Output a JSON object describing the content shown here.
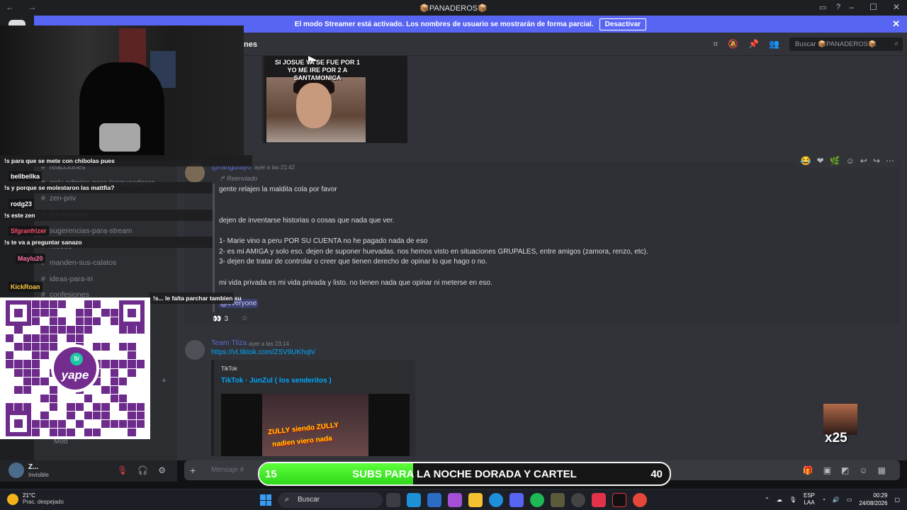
{
  "window": {
    "title": "📦PANADEROS📦"
  },
  "streamer_banner": {
    "text": "El modo Streamer está activado. Los nombres de usuario se mostrarán de forma parcial.",
    "button": "Desactivar"
  },
  "header": {
    "channel": "nes",
    "search_placeholder": "Buscar 📦PANADEROS📦"
  },
  "sidebar": {
    "channels": [
      "reacciones",
      "only-admins-para-tanqueadores",
      "zen-priv",
      "full-tanqueo",
      "sugerencias-para-stream",
      "moods",
      "manden-sus-calatos",
      "ideas-para-iri",
      "confesiones"
    ],
    "bottom_label": "Mod"
  },
  "video": {
    "caption": "SI JOSUE VA SE FUE POR 1\nYO ME IRE POR 2 A SANTAMONICA"
  },
  "message1": {
    "author": "@rangulayo",
    "timestamp": "ayer a las 21:42",
    "forwarded": "Reenviado",
    "lines": [
      "gente relajen la maldita cola por favor",
      "dejen de inventarse historias o cosas que nada que ver.",
      "1- Marie vino a peru POR SU CUENTA no he pagado nada de eso",
      "2- es mi AMIGA y solo eso. dejen de suponer huevadas. nos hemos visto en situaciones GRUPALES, entre amigos (zamora, renzo, etc).",
      "3- dejen de tratar de controlar o creer que tienen derecho de opinar lo que hago o no.",
      "mi vida privada es mi vida privada y listo. no tienen nada que opinar ni meterse en eso."
    ],
    "mention": "@everyone",
    "reaction_emoji": "👀",
    "reaction_count": "3"
  },
  "message2": {
    "author": "Team Tilza",
    "timestamp": "ayer a las 23:14",
    "link": "https://vt.tiktok.com/ZSV9UKhqh/",
    "embed_provider": "TikTok",
    "embed_title": "TikTok · JunZul ( los senderitos )",
    "embed_line1": "ZULLY siendo ZULLY",
    "embed_line2": "nadien viero nada"
  },
  "composer": {
    "placeholder": "Mensaje #"
  },
  "user": {
    "name": "Z...",
    "status": "Invisible"
  },
  "overlay_chat": [
    {
      "text": "!s para que se mete con chibolas pues"
    },
    {
      "user": "bellbellka",
      "color": "#ffffff"
    },
    {
      "text": "!s y porque se molestaron las mattfia?"
    },
    {
      "user": "rodg23",
      "color": "#ffffff"
    },
    {
      "text": "!s este zen"
    },
    {
      "user": "Sfgranfrizer",
      "color": "#ff4d6d"
    },
    {
      "text": "!s te va a preguntar sanazo"
    },
    {
      "user": "Maylu20",
      "color": "#ff6fa5"
    },
    {
      "user": "KickRoan",
      "color": "#ffc83d"
    },
    {
      "text": "!s... le falta parchar tambien su"
    }
  ],
  "qr": {
    "brand": "yape",
    "symbol": "S/"
  },
  "sub_goal": {
    "current": "15",
    "label": "SUBS PARA LA NOCHE DORADA Y CARTEL",
    "target": "40",
    "progress": 0.375
  },
  "multiplier": {
    "label": "x25"
  },
  "taskbar": {
    "temp": "21°C",
    "weather": "Prac. despejado",
    "search": "Buscar",
    "lang1": "ESP",
    "lang2": "LAA",
    "time": "00:29",
    "date": "24/08/2026"
  }
}
